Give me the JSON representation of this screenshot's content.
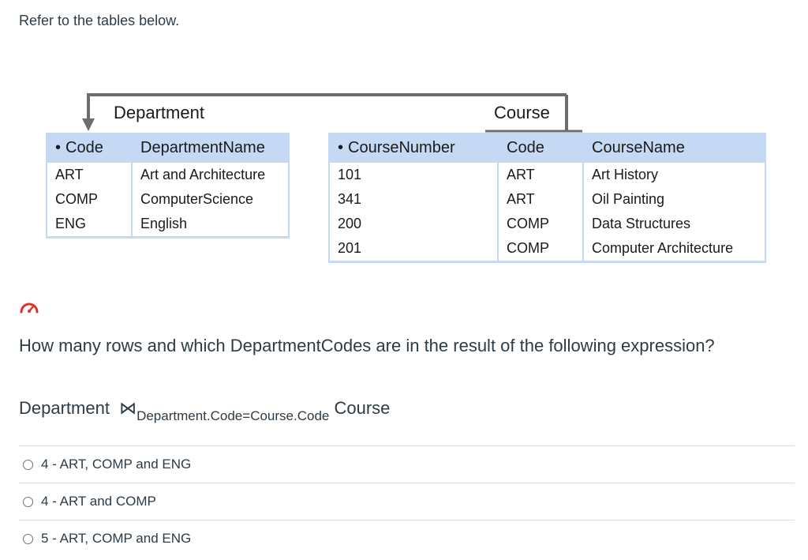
{
  "intro_text": "Refer to the tables below.",
  "department_table": {
    "title": "Department",
    "headers": [
      "Code",
      "DepartmentName"
    ],
    "rows": [
      [
        "ART",
        "Art and Architecture"
      ],
      [
        "COMP",
        "ComputerScience"
      ],
      [
        "ENG",
        "English"
      ]
    ]
  },
  "course_table": {
    "title": "Course",
    "headers": [
      "CourseNumber",
      "Code",
      "CourseName"
    ],
    "rows": [
      [
        "101",
        "ART",
        "Art History"
      ],
      [
        "341",
        "ART",
        "Oil Painting"
      ],
      [
        "200",
        "COMP",
        "Data Structures"
      ],
      [
        "201",
        "COMP",
        "Computer Architecture"
      ]
    ]
  },
  "icons": {
    "key_marker": "bullet-icon",
    "foreign_key_link": "arrow-icon",
    "difficulty": "gauge-icon"
  },
  "colors": {
    "table_header": "#c5d9f4",
    "arrow": "#6d6d6d",
    "gauge": "#d9342b"
  },
  "question": {
    "text": "How many rows and which DepartmentCodes are in  the result of the following expression?",
    "expression": {
      "left": "Department",
      "operator": "⋈",
      "condition": "Department.Code=Course.Code",
      "right": "Course"
    }
  },
  "options": [
    {
      "label": "4 - ART, COMP and ENG",
      "selected": false
    },
    {
      "label": "4 - ART and COMP",
      "selected": false
    },
    {
      "label": "5 - ART, COMP and ENG",
      "selected": false
    }
  ]
}
